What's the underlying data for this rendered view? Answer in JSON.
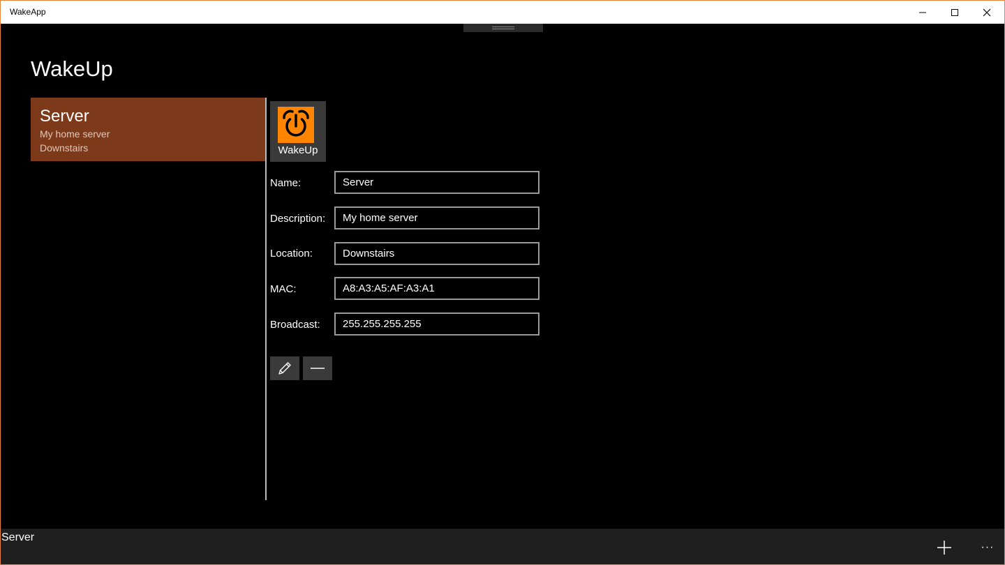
{
  "window": {
    "title": "WakeApp"
  },
  "page": {
    "title": "WakeUp"
  },
  "devices": [
    {
      "name": "Server",
      "description": "My home server",
      "location": "Downstairs"
    }
  ],
  "wake_button": {
    "label": "WakeUp"
  },
  "form": {
    "name_label": "Name:",
    "name_value": "Server",
    "description_label": "Description:",
    "description_value": "My home server",
    "location_label": "Location:",
    "location_value": "Downstairs",
    "mac_label": "MAC:",
    "mac_value": "A8:A3:A5:AF:A3:A1",
    "broadcast_label": "Broadcast:",
    "broadcast_value": "255.255.255.255"
  },
  "appbar": {
    "status": "Server",
    "more": "···"
  },
  "colors": {
    "accent": "#7c3a1a",
    "wake_icon_bg": "#ff8400",
    "window_border": "#e8813a"
  },
  "icons": {
    "wake": "power-alarm-icon",
    "edit": "pencil-icon",
    "remove": "minus-icon",
    "add": "plus-icon"
  }
}
